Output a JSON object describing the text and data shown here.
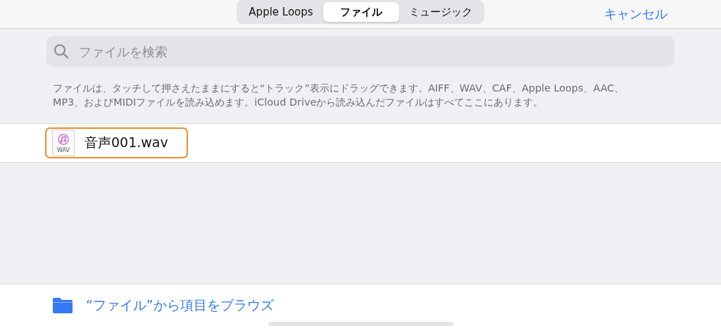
{
  "segments": [
    {
      "label": "Apple Loops",
      "selected": false
    },
    {
      "label": "ファイル",
      "selected": true
    },
    {
      "label": "ミュージック",
      "selected": false
    }
  ],
  "cancel": "キャンセル",
  "search": {
    "placeholder": "ファイルを検索"
  },
  "description": "ファイルは、タッチして押さえたままにすると“トラック”表示にドラッグできます。AIFF、WAV、CAF、Apple Loops、AAC、MP3、およびMIDIファイルを読み込めます。iCloud Driveから読み込んだファイルはすべてここにあります。",
  "files": [
    {
      "name": "音声001.wav",
      "icon_label": "WAV",
      "selected": true
    }
  ],
  "browse": "“ファイル”から項目をブラウズ"
}
